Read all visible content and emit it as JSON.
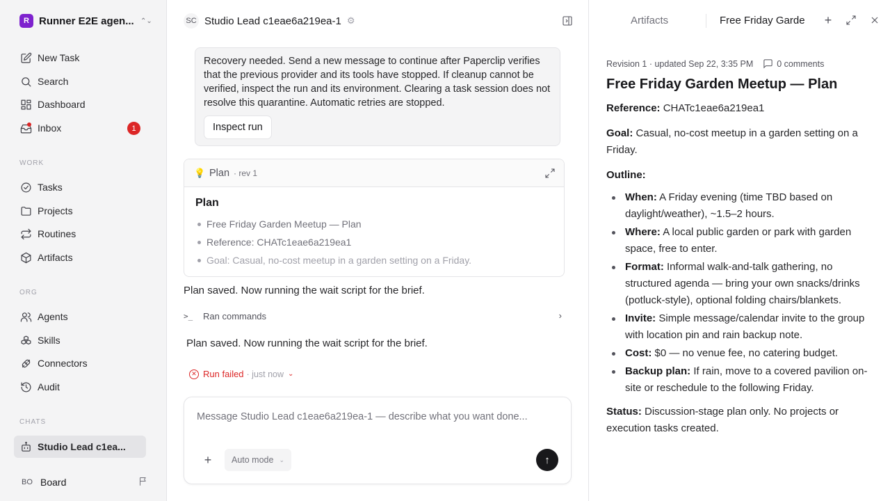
{
  "sidebar": {
    "workspace": {
      "initial": "R",
      "name": "Runner E2E agen..."
    },
    "main_items": [
      {
        "label": "New Task"
      },
      {
        "label": "Search"
      },
      {
        "label": "Dashboard"
      },
      {
        "label": "Inbox",
        "badge": "1"
      }
    ],
    "work_heading": "WORK",
    "work_items": [
      {
        "label": "Tasks"
      },
      {
        "label": "Projects"
      },
      {
        "label": "Routines"
      },
      {
        "label": "Artifacts"
      }
    ],
    "org_heading": "ORG",
    "org_items": [
      {
        "label": "Agents"
      },
      {
        "label": "Skills"
      },
      {
        "label": "Connectors"
      },
      {
        "label": "Audit"
      }
    ],
    "chats_heading": "CHATS",
    "chat_items": [
      {
        "label": "Studio Lead c1ea..."
      }
    ],
    "user": {
      "initials": "BO",
      "name": "Board"
    }
  },
  "chat": {
    "avatar": "SC",
    "title": "Studio Lead c1eae6a219ea-1",
    "recovery": {
      "text": "Recovery needed. Send a new message to continue after Paperclip verifies that the previous provider and its tools have stopped. If cleanup cannot be verified, inspect the run and its environment. Clearing a task session does not resolve this quarantine. Automatic retries are stopped.",
      "button": "Inspect run"
    },
    "plan_card": {
      "label": "Plan",
      "rev": "· rev 1",
      "title": "Plan",
      "items": [
        "Free Friday Garden Meetup — Plan",
        "Reference: CHATc1eae6a219ea1",
        "Goal: Casual, no-cost meetup in a garden setting on a Friday."
      ]
    },
    "message_1": "Plan saved. Now running the wait script for the brief.",
    "ran_commands": "Ran commands",
    "message_2": "Plan saved. Now running the wait script for the brief.",
    "run_status": {
      "label": "Run failed",
      "time": "· just now"
    },
    "composer": {
      "placeholder": "Message Studio Lead c1eae6a219ea-1 — describe what you want done...",
      "mode": "Auto mode"
    }
  },
  "right_panel": {
    "tab_artifacts": "Artifacts",
    "tab_doc": "Free Friday Garden Meetup — Plan",
    "meta": {
      "revision": "Revision 1 · updated Sep 22, 3:35 PM",
      "comments": "0 comments"
    },
    "doc": {
      "title": "Free Friday Garden Meetup — Plan",
      "reference_label": "Reference:",
      "reference_value": "CHATc1eae6a219ea1",
      "goal_label": "Goal:",
      "goal_value": "Casual, no-cost meetup in a garden setting on a Friday.",
      "outline_label": "Outline:",
      "outline": [
        {
          "label": "When:",
          "text": "A Friday evening (time TBD based on daylight/weather), ~1.5–2 hours."
        },
        {
          "label": "Where:",
          "text": "A local public garden or park with garden space, free to enter."
        },
        {
          "label": "Format:",
          "text": "Informal walk-and-talk gathering, no structured agenda — bring your own snacks/drinks (potluck-style), optional folding chairs/blankets."
        },
        {
          "label": "Invite:",
          "text": "Simple message/calendar invite to the group with location pin and rain backup note."
        },
        {
          "label": "Cost:",
          "text": "$0 — no venue fee, no catering budget."
        },
        {
          "label": "Backup plan:",
          "text": "If rain, move to a covered pavilion on-site or reschedule to the following Friday."
        }
      ],
      "status_label": "Status:",
      "status_value": "Discussion-stage plan only. No projects or execution tasks created."
    }
  }
}
